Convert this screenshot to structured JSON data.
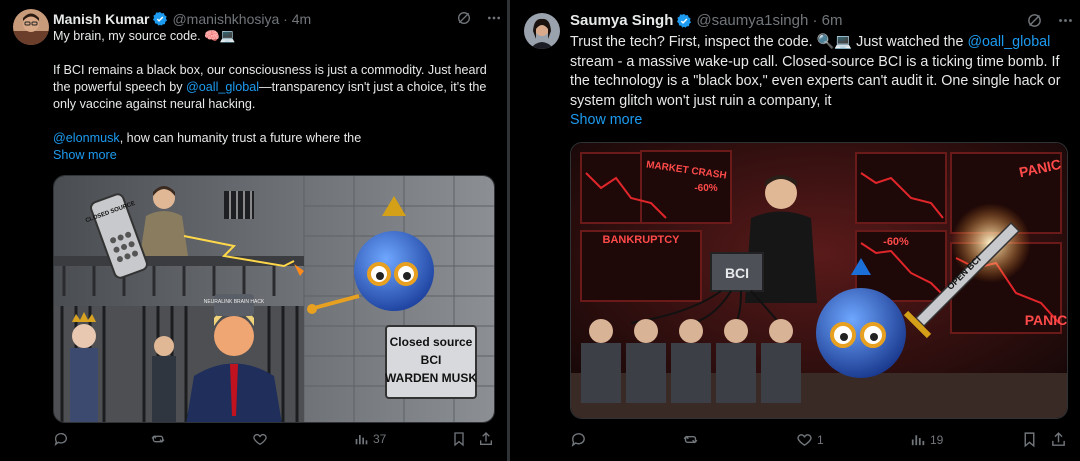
{
  "tweets": [
    {
      "author": {
        "name": "Manish Kumar",
        "handle": "@manishkhosiya",
        "time": "4m",
        "avatar_icon": "man-avatar"
      },
      "text": {
        "line1": "My brain, my source code. 🧠💻",
        "para2_a": "If BCI remains a black box, our consciousness is just a commodity. Just heard the powerful speech by ",
        "para2_link": "@oall_global",
        "para2_b": "—transparency isn't just a choice, it's the only vaccine against neural hacking.",
        "para3_link": "@elonmusk",
        "para3_b": ", how can humanity trust a future where the",
        "show_more": "Show more"
      },
      "image": {
        "remote_label": "CLOSED SOURCE",
        "helmet_label": "NEURALINK BRAIN HACK",
        "sign_line1": "Closed source",
        "sign_line2": "BCI",
        "sign_line3": "WARDEN MUSK"
      },
      "actions": {
        "reply": "",
        "repost": "",
        "like": "",
        "views": "37"
      }
    },
    {
      "author": {
        "name": "Saumya Singh",
        "handle": "@saumya1singh",
        "time": "6m",
        "avatar_icon": "woman-avatar"
      },
      "text": {
        "a": "Trust the tech? First, inspect the code. 🔍💻 Just watched the ",
        "link": "@oall_global",
        "b": " stream - a massive wake-up call. Closed-source BCI is a ticking time bomb. If the technology is a \"black box,\" even experts can't audit it. One single hack or system glitch won't just ruin a company, it",
        "show_more": "Show more"
      },
      "image": {
        "screen1": "MARKET CRASH",
        "screen1_pct": "-60%",
        "screen2": "BANKRUPTCY",
        "screen3_pct": "-60%",
        "panic1": "PANIC",
        "panic2": "PANIC",
        "box_label": "BCI",
        "sword_label": "OPEN BCI"
      },
      "actions": {
        "reply": "",
        "repost": "",
        "like": "1",
        "views": "19"
      }
    }
  ],
  "colors": {
    "link": "#1d9bf0",
    "muted": "#71767b",
    "verified": "#1d9bf0",
    "divider": "#2f3336"
  }
}
